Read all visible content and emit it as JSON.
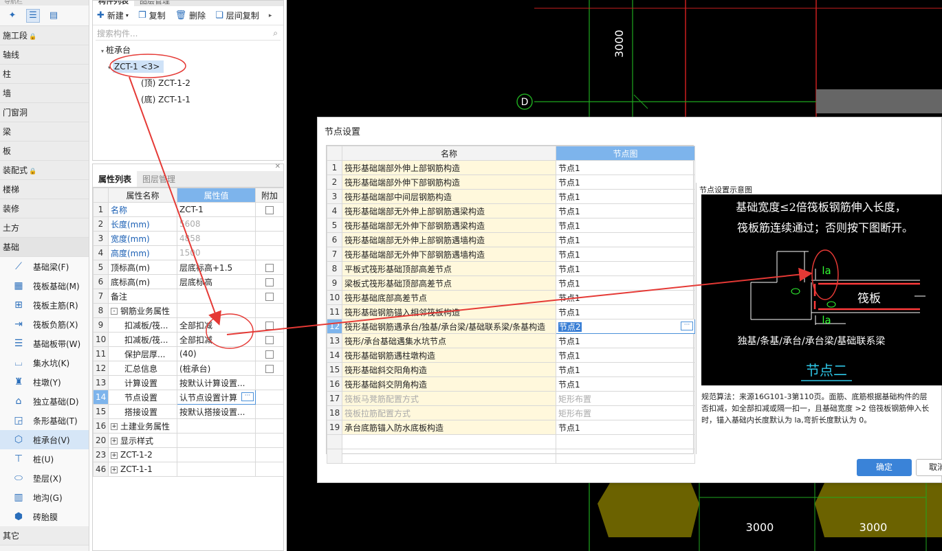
{
  "left_nav": {
    "title": "导航栏",
    "categories_top": [
      {
        "label": "施工段",
        "locked": true
      },
      {
        "label": "轴线"
      },
      {
        "label": "柱"
      },
      {
        "label": "墙"
      },
      {
        "label": "门窗洞"
      },
      {
        "label": "梁"
      },
      {
        "label": "板"
      },
      {
        "label": "装配式",
        "locked": true
      },
      {
        "label": "楼梯"
      },
      {
        "label": "装修"
      },
      {
        "label": "土方"
      },
      {
        "label": "基础"
      }
    ],
    "foundation_items": [
      {
        "label": "基础梁(F)",
        "icon": "beam-icon"
      },
      {
        "label": "筏板基础(M)",
        "icon": "raft-icon"
      },
      {
        "label": "筏板主筋(R)",
        "icon": "main-rebar-icon"
      },
      {
        "label": "筏板负筋(X)",
        "icon": "neg-rebar-icon"
      },
      {
        "label": "基础板带(W)",
        "icon": "slab-band-icon"
      },
      {
        "label": "集水坑(K)",
        "icon": "sump-icon"
      },
      {
        "label": "柱墩(Y)",
        "icon": "column-pier-icon"
      },
      {
        "label": "独立基础(D)",
        "icon": "isolated-footing-icon"
      },
      {
        "label": "条形基础(T)",
        "icon": "strip-footing-icon"
      },
      {
        "label": "桩承台(V)",
        "icon": "pile-cap-icon"
      },
      {
        "label": "桩(U)",
        "icon": "pile-icon"
      },
      {
        "label": "垫层(X)",
        "icon": "cushion-icon"
      },
      {
        "label": "地沟(G)",
        "icon": "trench-icon"
      },
      {
        "label": "砖胎膜",
        "icon": "brick-mould-icon"
      }
    ],
    "selected_item_index": 9,
    "category_bottom": "其它"
  },
  "comp_panel": {
    "tabs": [
      "构件列表",
      "图层管理"
    ],
    "toolbar": {
      "new": "新建",
      "copy": "复制",
      "delete": "删除",
      "floor_copy": "层间复制"
    },
    "search_placeholder": "搜索构件...",
    "tree": {
      "root": "桩承台",
      "selected": "ZCT-1 <3>",
      "children": [
        "(顶) ZCT-1-2",
        "(底) ZCT-1-1"
      ]
    }
  },
  "prop_panel": {
    "tabs": [
      "属性列表",
      "图层管理"
    ],
    "headers": [
      "属性名称",
      "属性值",
      "附加"
    ],
    "rows": [
      {
        "n": "1",
        "name": "名称",
        "value": "ZCT-1",
        "cb": true,
        "blue": true
      },
      {
        "n": "2",
        "name": "长度(mm)",
        "value": "5608",
        "blue": true,
        "gray": true
      },
      {
        "n": "3",
        "name": "宽度(mm)",
        "value": "4858",
        "blue": true,
        "gray": true
      },
      {
        "n": "4",
        "name": "高度(mm)",
        "value": "1500",
        "blue": true,
        "gray": true
      },
      {
        "n": "5",
        "name": "顶标高(m)",
        "value": "层底标高+1.5",
        "cb": true
      },
      {
        "n": "6",
        "name": "底标高(m)",
        "value": "层底标高",
        "cb": true
      },
      {
        "n": "7",
        "name": "备注",
        "value": "",
        "cb": true
      },
      {
        "n": "8",
        "name": "钢筋业务属性",
        "value": "",
        "group": "-"
      },
      {
        "n": "9",
        "name": "扣减板/筏...",
        "value": "全部扣减",
        "cb": true,
        "indent": 2
      },
      {
        "n": "10",
        "name": "扣减板/筏...",
        "value": "全部扣减",
        "cb": true,
        "indent": 2
      },
      {
        "n": "11",
        "name": "保护层厚...",
        "value": "(40)",
        "cb": true,
        "indent": 2
      },
      {
        "n": "12",
        "name": "汇总信息",
        "value": "(桩承台)",
        "cb": true,
        "indent": 2
      },
      {
        "n": "13",
        "name": "计算设置",
        "value": "按默认计算设置...",
        "indent": 2
      },
      {
        "n": "14",
        "name": "节点设置",
        "value": "认节点设置计算",
        "indent": 2,
        "editing": true
      },
      {
        "n": "15",
        "name": "搭接设置",
        "value": "按默认搭接设置...",
        "indent": 2
      },
      {
        "n": "16",
        "name": "土建业务属性",
        "value": "",
        "group": "+"
      },
      {
        "n": "20",
        "name": "显示样式",
        "value": "",
        "group": "+"
      },
      {
        "n": "23",
        "name": "ZCT-1-2",
        "value": "",
        "group": "+"
      },
      {
        "n": "46",
        "name": "ZCT-1-1",
        "value": "",
        "group": "+"
      }
    ],
    "selected_row_number": "14"
  },
  "cad": {
    "dim_top": "3000",
    "axis_label": "D",
    "dim_bottom_left": "3000",
    "dim_bottom_right": "3000"
  },
  "dialog": {
    "title": "节点设置",
    "headers": [
      "名称",
      "节点图"
    ],
    "rows": [
      {
        "n": "1",
        "name": "筏形基础端部外伸上部钢筋构造",
        "value": "节点1"
      },
      {
        "n": "2",
        "name": "筏形基础端部外伸下部钢筋构造",
        "value": "节点1"
      },
      {
        "n": "3",
        "name": "筏形基础端部中间层钢筋构造",
        "value": "节点1"
      },
      {
        "n": "4",
        "name": "筏形基础端部无外伸上部钢筋遇梁构造",
        "value": "节点1"
      },
      {
        "n": "5",
        "name": "筏形基础端部无外伸下部钢筋遇梁构造",
        "value": "节点1"
      },
      {
        "n": "6",
        "name": "筏形基础端部无外伸上部钢筋遇墙构造",
        "value": "节点1"
      },
      {
        "n": "7",
        "name": "筏形基础端部无外伸下部钢筋遇墙构造",
        "value": "节点1"
      },
      {
        "n": "8",
        "name": "平板式筏形基础顶部高差节点",
        "value": "节点1"
      },
      {
        "n": "9",
        "name": "梁板式筏形基础顶部高差节点",
        "value": "节点1"
      },
      {
        "n": "10",
        "name": "筏形基础底部高差节点",
        "value": "节点1"
      },
      {
        "n": "11",
        "name": "筏形基础钢筋锚入相邻筏板构造",
        "value": "节点1"
      },
      {
        "n": "12",
        "name": "筏形基础钢筋遇承台/独基/承台梁/基础联系梁/条基构造",
        "value": "节点2",
        "selected": true
      },
      {
        "n": "13",
        "name": "筏形/承台基础遇集水坑节点",
        "value": "节点1"
      },
      {
        "n": "14",
        "name": "筏形基础钢筋遇柱墩构造",
        "value": "节点1"
      },
      {
        "n": "15",
        "name": "筏形基础斜交阳角构造",
        "value": "节点1"
      },
      {
        "n": "16",
        "name": "筏形基础斜交阴角构造",
        "value": "节点1"
      },
      {
        "n": "17",
        "name": "筏板马凳筋配置方式",
        "value": "矩形布置",
        "disabled": true
      },
      {
        "n": "18",
        "name": "筏板拉筋配置方式",
        "value": "矩形布置",
        "disabled": true
      },
      {
        "n": "19",
        "name": "承台底筋锚入防水底板构造",
        "value": "节点1"
      }
    ],
    "preview": {
      "title": "节点设置示意图",
      "line1": "基础宽度≤2倍筏板钢筋伸入长度，",
      "line2": "筏板筋连续通过；否则按下图断开。",
      "la_top": "la",
      "la_bottom": "la",
      "raft_label": "筏板",
      "foundation_label": "独基/条基/承台/承台梁/基础联系梁",
      "node_name": "节点二"
    },
    "note_lines": [
      "规范算法：来源16G101-3第110页。面筋、底筋根据基础构件的层",
      "否扣减，如全部扣减或隔一扣一，且基础宽度 >2 倍筏板钢筋伸入长",
      "时，锚入基础内长度默认为 la,弯折长度默认为 0。"
    ],
    "ok": "确定",
    "cancel": "取消"
  },
  "colors": {
    "accent": "#3a83d8",
    "header_highlight": "#7db4ec",
    "name_cell_bg": "#fff8dc",
    "annotation_red": "#e53935",
    "cad_green": "#1fa81f",
    "cad_red": "#cc1f1f",
    "cad_olive": "#6b6200"
  }
}
